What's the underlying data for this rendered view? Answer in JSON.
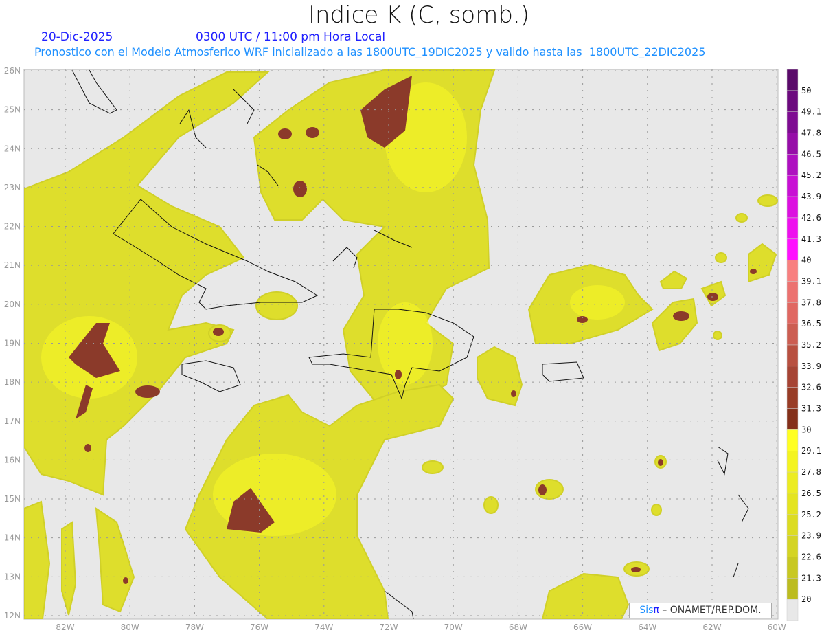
{
  "header": {
    "title": "Indice K (C, somb.)",
    "date": "20-Dic-2025",
    "time": "0300 UTC / 11:00 pm Hora Local",
    "subtitle": "Pronostico con el Modelo Atmosferico WRF inicializado a las 1800UTC_19DIC2025 y valido hasta las  1800UTC_22DIC2025"
  },
  "map": {
    "lon_labels": [
      "82W",
      "80W",
      "78W",
      "76W",
      "74W",
      "72W",
      "70W",
      "68W",
      "66W",
      "64W",
      "62W",
      "60W"
    ],
    "lat_labels": [
      "26N",
      "25N",
      "24N",
      "23N",
      "22N",
      "21N",
      "20N",
      "19N",
      "18N",
      "17N",
      "16N",
      "15N",
      "14N",
      "13N",
      "12N"
    ],
    "background_color": "#e8e8e8"
  },
  "colorbar": {
    "labels": [
      "50",
      "49.1",
      "47.8",
      "46.5",
      "45.2",
      "43.9",
      "42.6",
      "41.3",
      "40",
      "39.1",
      "37.8",
      "36.5",
      "35.2",
      "33.9",
      "32.6",
      "31.3",
      "30",
      "29.1",
      "27.8",
      "26.5",
      "25.2",
      "23.9",
      "22.6",
      "21.3",
      "20"
    ],
    "colors": [
      "#5a0a6a",
      "#6c0a7e",
      "#7e0c92",
      "#960ea8",
      "#ae10c0",
      "#c810d4",
      "#dc10e0",
      "#ee10ee",
      "#ff10ff",
      "#f88080",
      "#ec7270",
      "#e06862",
      "#cc5e52",
      "#b85040",
      "#a64434",
      "#983c26",
      "#84301a",
      "#ffff22",
      "#f4f420",
      "#ecec22",
      "#e4e420",
      "#dcdc22",
      "#d4d424",
      "#c8c822",
      "#bcbc20",
      "#e8e8e8"
    ]
  },
  "footer": {
    "logo_sis": "Sis",
    "logo_pi": "π",
    "logo_text": " – ONAMET/REP.DOM."
  }
}
